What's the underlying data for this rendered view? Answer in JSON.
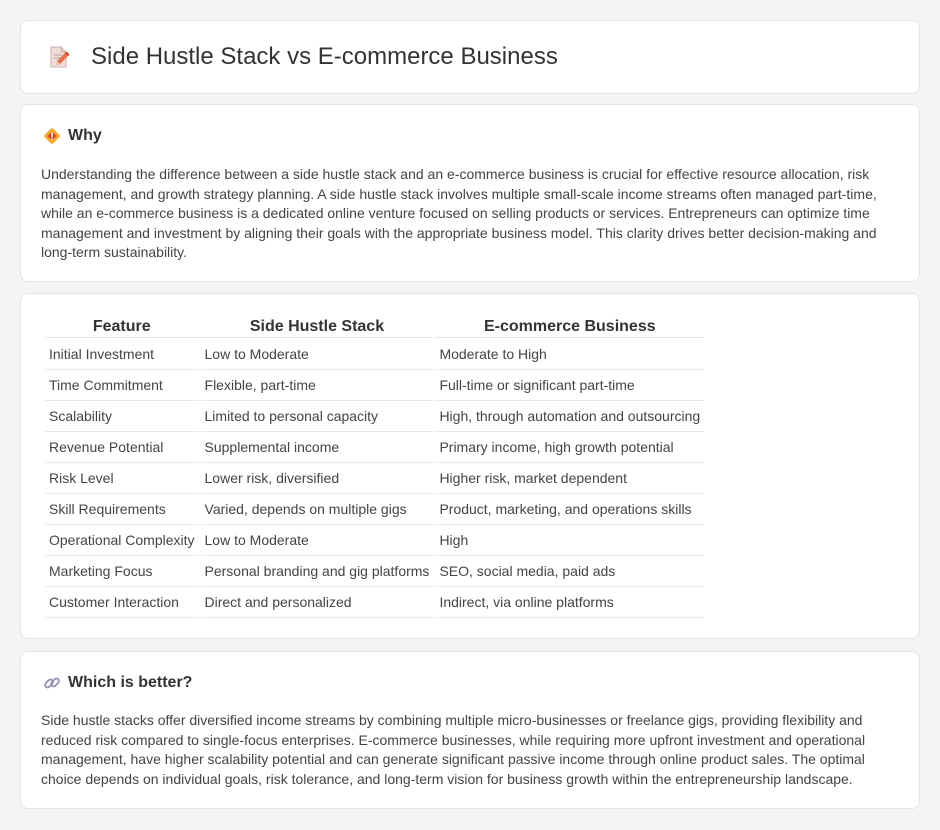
{
  "header": {
    "title": "Side Hustle Stack vs E-commerce Business",
    "icon": "document-pencil-icon"
  },
  "why": {
    "heading": "Why",
    "icon": "diamond-warning-icon",
    "text": "Understanding the difference between a side hustle stack and an e-commerce business is crucial for effective resource allocation, risk management, and growth strategy planning. A side hustle stack involves multiple small-scale income streams often managed part-time, while an e-commerce business is a dedicated online venture focused on selling products or services. Entrepreneurs can optimize time management and investment by aligning their goals with the appropriate business model. This clarity drives better decision-making and long-term sustainability."
  },
  "table": {
    "columns": [
      "Feature",
      "Side Hustle Stack",
      "E-commerce Business"
    ],
    "rows": [
      [
        "Initial Investment",
        "Low to Moderate",
        "Moderate to High"
      ],
      [
        "Time Commitment",
        "Flexible, part-time",
        "Full-time or significant part-time"
      ],
      [
        "Scalability",
        "Limited to personal capacity",
        "High, through automation and outsourcing"
      ],
      [
        "Revenue Potential",
        "Supplemental income",
        "Primary income, high growth potential"
      ],
      [
        "Risk Level",
        "Lower risk, diversified",
        "Higher risk, market dependent"
      ],
      [
        "Skill Requirements",
        "Varied, depends on multiple gigs",
        "Product, marketing, and operations skills"
      ],
      [
        "Operational Complexity",
        "Low to Moderate",
        "High"
      ],
      [
        "Marketing Focus",
        "Personal branding and gig platforms",
        "SEO, social media, paid ads"
      ],
      [
        "Customer Interaction",
        "Direct and personalized",
        "Indirect, via online platforms"
      ]
    ]
  },
  "better": {
    "heading": "Which is better?",
    "icon": "link-icon",
    "text": "Side hustle stacks offer diversified income streams by combining multiple micro-businesses or freelance gigs, providing flexibility and reduced risk compared to single-focus enterprises. E-commerce businesses, while requiring more upfront investment and operational management, have higher scalability potential and can generate significant passive income through online product sales. The optimal choice depends on individual goals, risk tolerance, and long-term vision for business growth within the entrepreneurship landscape."
  },
  "colors": {
    "background": "#f3f4f6",
    "card": "#ffffff",
    "border": "#e3e4e8",
    "text": "#444444",
    "heading": "#333333"
  }
}
